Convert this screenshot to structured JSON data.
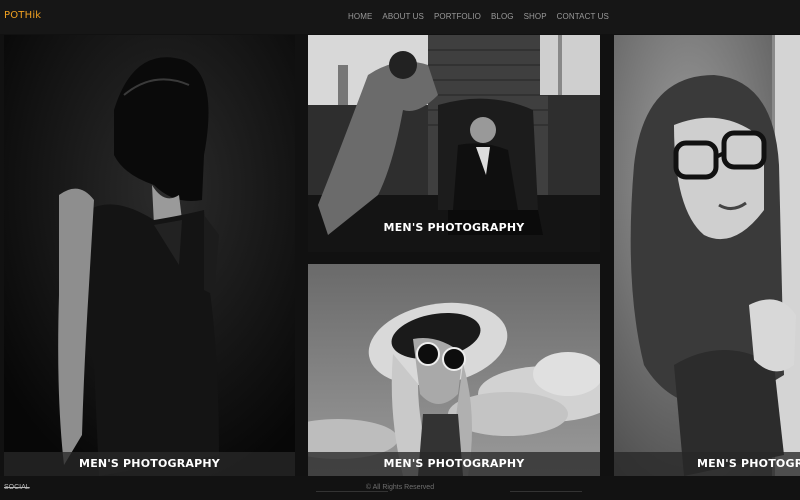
{
  "brand": {
    "name": "POTHik"
  },
  "nav": {
    "items": [
      "HOME",
      "ABOUT US",
      "PORTFOLIO",
      "BLOG",
      "SHOP",
      "CONTACT US"
    ]
  },
  "gallery": {
    "tiles": [
      {
        "caption": "MEN'S PHOTOGRAPHY",
        "subject": "woman in black dress with hair over eyes"
      },
      {
        "caption": "MEN'S PHOTOGRAPHY",
        "subject": "photographer shooting seated man"
      },
      {
        "caption": "MEN'S PHOTOGRAPHY",
        "subject": "woman in sun hat and sunglasses"
      },
      {
        "caption": "MEN'S PHOTOGRAPHY",
        "subject": "woman in glasses behind door"
      }
    ]
  },
  "footer": {
    "social_label": "SOCIAL",
    "copyright": "© All Rights Reserved"
  }
}
